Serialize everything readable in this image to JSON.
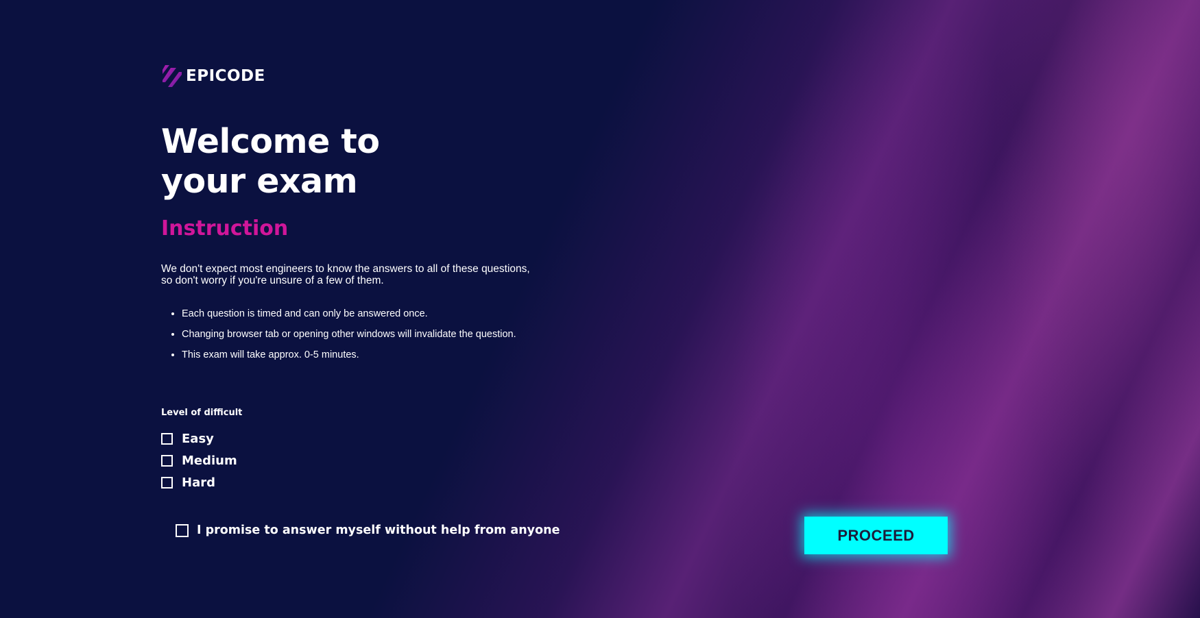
{
  "brand": {
    "name": "EPICODE",
    "icon": "epicode-logo-icon",
    "colors": {
      "background": "#0b1140",
      "accent_magenta": "#d0169a",
      "button_cyan": "#00ffff",
      "logo_gradient_start": "#c21eb0",
      "logo_gradient_end": "#5b1ea0"
    }
  },
  "header": {
    "title_line1": "Welcome to",
    "title_line2": "your exam"
  },
  "instruction": {
    "heading": "Instruction",
    "intro": "We don't expect most engineers to know the answers to all of these questions, so don't worry if you're unsure of a few of them.",
    "rules": [
      "Each question is timed and can only be answered once.",
      "Changing browser tab or opening other windows will invalidate the question.",
      "This exam will take approx. 0-5 minutes."
    ]
  },
  "difficulty": {
    "label": "Level of difficult",
    "options": [
      {
        "label": "Easy",
        "checked": false
      },
      {
        "label": "Medium",
        "checked": false
      },
      {
        "label": "Hard",
        "checked": false
      }
    ]
  },
  "promise": {
    "label": "I promise to answer myself without help from anyone",
    "checked": false
  },
  "actions": {
    "proceed_label": "PROCEED"
  }
}
